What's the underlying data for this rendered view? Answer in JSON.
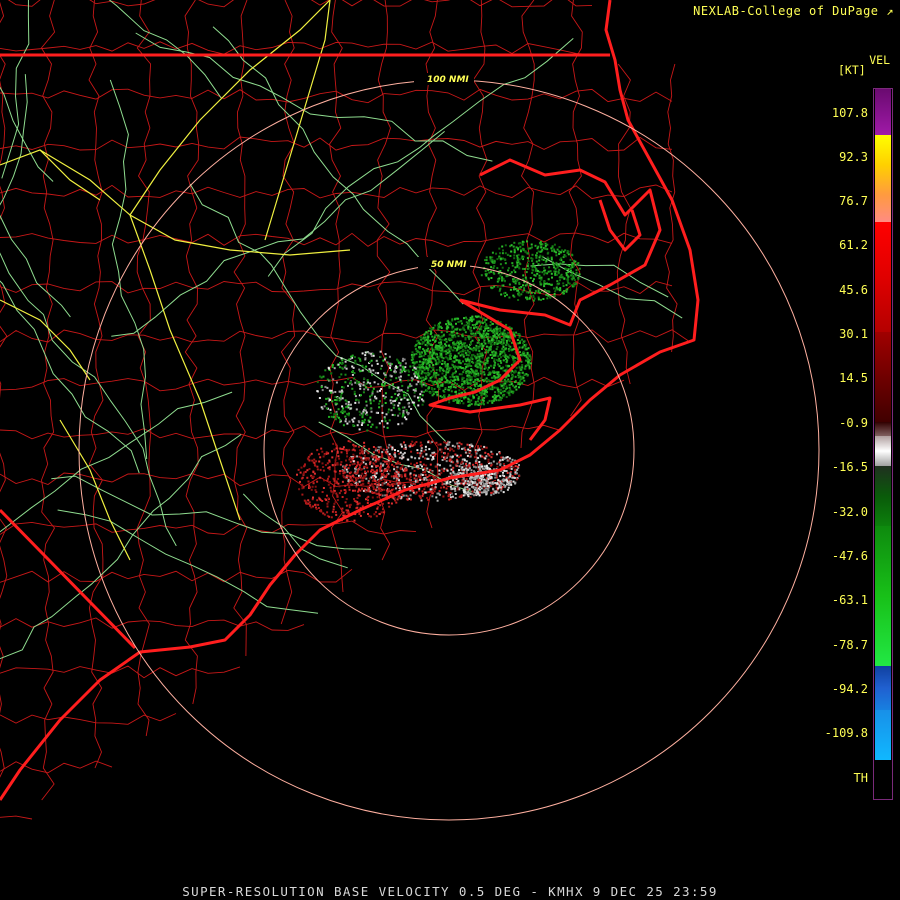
{
  "credit": "NEXLAB-College of DuPage",
  "credit_icon": "external-link-icon",
  "footer": "SUPER-RESOLUTION BASE VELOCITY 0.5 DEG - KMHX 9 DEC 25 23:59",
  "legend": {
    "title": "VEL",
    "unit": "[KT]",
    "labels": [
      "107.8",
      "92.3",
      "76.7",
      "61.2",
      "45.6",
      "30.1",
      "14.5",
      "-0.9",
      "-16.5",
      "-32.0",
      "-47.6",
      "-63.1",
      "-78.7",
      "-94.2",
      "-109.8",
      "TH"
    ]
  },
  "range_rings": [
    "50 NMI",
    "100 NMI"
  ],
  "colors": {
    "state_border": "#ff2020",
    "county_border": "#cc1a1a",
    "highway": "#90e090",
    "interstate": "#ffff40",
    "ring": "#ffb0a0",
    "inbound": "#22aa22",
    "outbound": "#cc2222",
    "near_zero": "#cccccc"
  }
}
